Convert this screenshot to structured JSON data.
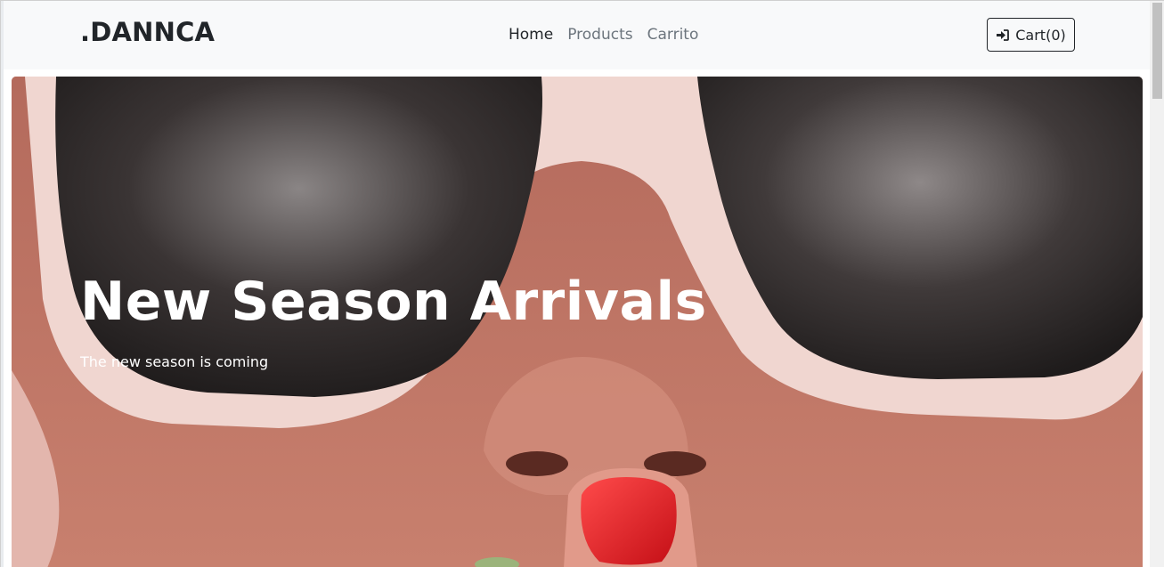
{
  "navbar": {
    "brand": ".DANNCA",
    "links": [
      {
        "label": "Home",
        "active": true
      },
      {
        "label": "Products",
        "active": false
      },
      {
        "label": "Carrito",
        "active": false
      }
    ],
    "cart": {
      "label": "Cart(0)",
      "icon": "sign-in-icon"
    }
  },
  "hero": {
    "title": "New Season Arrivals",
    "subtitle": "The new season is coming",
    "image": "woman-with-white-sunglasses"
  },
  "colors": {
    "navbar_bg": "#f8f9fa",
    "text_dark": "#212529",
    "text_muted": "#6c757d",
    "hero_text": "#ffffff"
  }
}
